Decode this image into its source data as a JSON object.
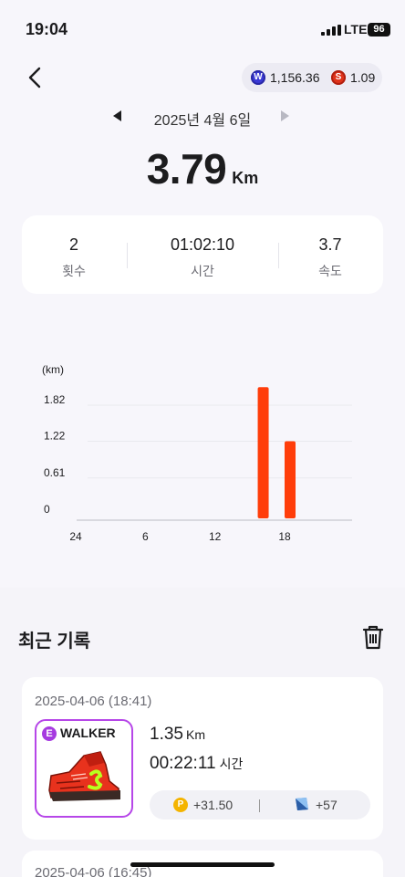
{
  "status": {
    "time": "19:04",
    "network": "LTE",
    "battery": "96"
  },
  "header": {
    "wallet": [
      {
        "icon": "w-coin-icon",
        "symbol": "W",
        "value": "1,156.36"
      },
      {
        "icon": "s-coin-icon",
        "symbol": "S",
        "value": "1.09"
      }
    ]
  },
  "date_nav": {
    "label": "2025년 4월 6일"
  },
  "summary": {
    "distance": "3.79",
    "distance_unit": "Km"
  },
  "stats": [
    {
      "value": "2",
      "label": "횟수"
    },
    {
      "value": "01:02:10",
      "label": "시간"
    },
    {
      "value": "3.7",
      "label": "속도"
    }
  ],
  "chart_data": {
    "type": "bar",
    "ylabel": "(km)",
    "yticks": [
      "1.82",
      "1.22",
      "0.61",
      "0"
    ],
    "ytick_values": [
      1.82,
      1.22,
      0.61,
      0
    ],
    "xticks": [
      "24",
      "6",
      "12",
      "18"
    ],
    "x_hours_start": 0,
    "x_hours_end": 24,
    "ylim": [
      0,
      1.82
    ],
    "bar_color": "#ff3d0a",
    "bars": [
      {
        "hour": 16,
        "value": 2.12
      },
      {
        "hour": 18,
        "value": 1.22
      }
    ],
    "grid": true
  },
  "recent": {
    "title": "최근 기록",
    "records": [
      {
        "date": "2025-04-06 (18:41)",
        "badge": "E",
        "shoe_type": "WALKER",
        "distance": "1.35",
        "distance_unit": "Km",
        "duration": "00:22:11",
        "duration_label": "시간",
        "points": "+31.50",
        "gems": "+57"
      },
      {
        "date": "2025-04-06 (16:45)"
      }
    ]
  }
}
